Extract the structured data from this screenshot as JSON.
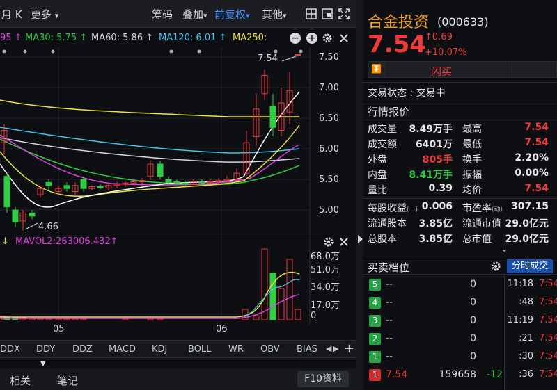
{
  "toolbar": {
    "period": "月 K",
    "more": "更多",
    "chips": "筹码",
    "overlay": "叠加",
    "adjust": "前复权",
    "other": "其他"
  },
  "ma": {
    "ma_first": "95 ↑",
    "ma30": "MA30: 5.75 ↑",
    "ma60": "MA60: 5.86 ↑",
    "ma120": "MA120: 6.01 ↑",
    "ma250": "MA250:"
  },
  "price_axis": [
    "7.50",
    "7.00",
    "6.50",
    "6.00",
    "5.50",
    "5.00"
  ],
  "high_label": "7.54",
  "low_label": "4.66",
  "volume": {
    "mavol": "MAVOL2:263006.432↑",
    "axis": [
      "68.0万",
      "51.0万",
      "34.0万",
      "17.0万",
      "0"
    ]
  },
  "date_labels": [
    "05",
    "06"
  ],
  "indicator_tabs": [
    "DDX",
    "DDY",
    "DDZ",
    "MACD",
    "KDJ",
    "BOLL",
    "WR",
    "OBV",
    "BIAS"
  ],
  "bottom": {
    "related": "相关",
    "notes": "笔记",
    "f10": "F10资料"
  },
  "stock": {
    "name": "合金投资",
    "code": "(000633)",
    "price": "7.54",
    "change": "0.69",
    "change_pct": "+10.07%",
    "flash_trade": "闪买"
  },
  "status": "交易状态 : 交易中",
  "quote_title": "行情报价",
  "quote": [
    {
      "l1": "成交量",
      "v1": "8.49万手",
      "l2": "最高",
      "v2": "7.54"
    },
    {
      "l1": "成交额",
      "v1": "6401万",
      "l2": "最低",
      "v2": "7.54"
    },
    {
      "l1": "外盘",
      "v1": "805手",
      "l2": "换手",
      "v2": "2.20%"
    },
    {
      "l1": "内盘",
      "v1": "8.41万手",
      "l2": "振幅",
      "v2": "0.00%"
    },
    {
      "l1": "量比",
      "v1": "0.39",
      "l2": "均价",
      "v2": "7.54"
    }
  ],
  "fundamentals": [
    {
      "l1": "每股收益",
      "sub": "(一)",
      "v1": "0.006",
      "l2": "市盈率",
      "sub2": "(动)",
      "v2": "307.15"
    },
    {
      "l1": "流通股本",
      "sub": "",
      "v1": "3.85亿",
      "l2": "流通市值",
      "sub2": "",
      "v2": "29.0亿元"
    },
    {
      "l1": "总股本",
      "sub": "",
      "v1": "3.85亿",
      "l2": "总市值",
      "sub2": "",
      "v2": "29.0亿元"
    }
  ],
  "orderbook": {
    "title": "买卖档位",
    "tab": "分时成交",
    "levels": [
      {
        "n": "5",
        "price": "--",
        "vol": "0"
      },
      {
        "n": "4",
        "price": "--",
        "vol": "0"
      },
      {
        "n": "3",
        "price": "--",
        "vol": "0"
      },
      {
        "n": "2",
        "price": "--",
        "vol": "0"
      },
      {
        "n": "1",
        "price": "--",
        "vol": "0"
      },
      {
        "n": "1",
        "price": "7.54",
        "vol": "159658",
        "delta": "-12"
      }
    ],
    "ticks": [
      {
        "t": "11:18",
        "p": "7.54"
      },
      {
        "t": ":48",
        "p": "7.54"
      },
      {
        "t": "11:19",
        "p": "7.54"
      },
      {
        "t": ":21",
        "p": "7.54"
      },
      {
        "t": ":30",
        "p": "7.54"
      },
      {
        "t": ":36",
        "p": "7.54"
      }
    ]
  },
  "colors": {
    "up": "#f23a3a",
    "down": "#2ecc40",
    "accent": "#3f8cff",
    "name": "#f0a020"
  }
}
